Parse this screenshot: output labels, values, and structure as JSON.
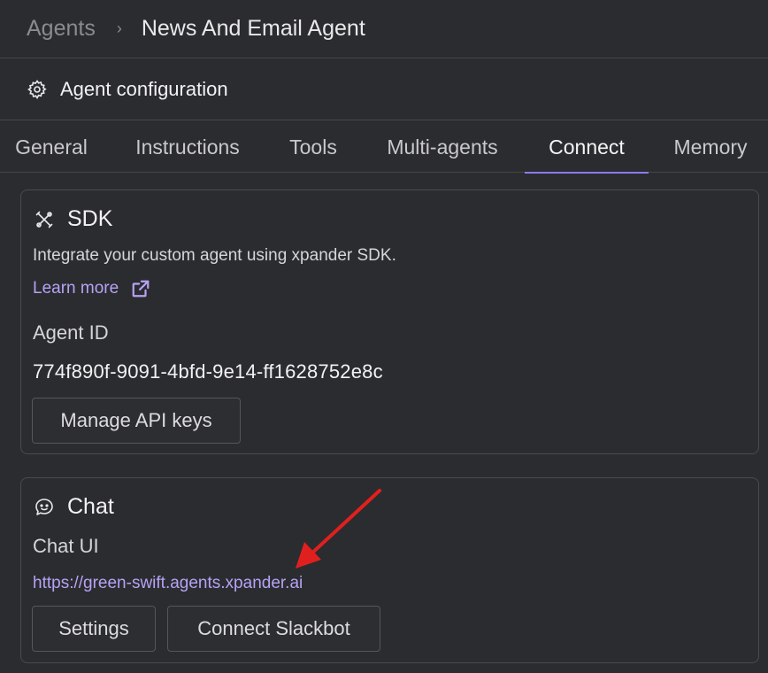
{
  "breadcrumb": {
    "parent": "Agents",
    "separator": "›",
    "current": "News And Email Agent"
  },
  "config": {
    "icon": "gear-icon",
    "title": "Agent configuration"
  },
  "tabs": [
    {
      "label": "General"
    },
    {
      "label": "Instructions"
    },
    {
      "label": "Tools"
    },
    {
      "label": "Multi-agents"
    },
    {
      "label": "Connect",
      "active": true
    },
    {
      "label": "Memory"
    }
  ],
  "sdk": {
    "icon": "tools-cross-icon",
    "title": "SDK",
    "description": "Integrate your custom agent using xpander SDK.",
    "learn_more": "Learn more",
    "agent_id_label": "Agent ID",
    "agent_id": "774f890f-9091-4bfd-9e14-ff1628752e8c",
    "manage_keys_button": "Manage API keys"
  },
  "chat": {
    "icon": "bot-face-icon",
    "title": "Chat",
    "chat_ui_label": "Chat UI",
    "chat_url": "https://green-swift.agents.xpander.ai",
    "settings_button": "Settings",
    "slackbot_button": "Connect Slackbot"
  },
  "colors": {
    "background": "#2b2c2f",
    "accent": "#8b7cf6",
    "link": "#b7a2f5",
    "annotation_arrow": "#e0201f"
  }
}
